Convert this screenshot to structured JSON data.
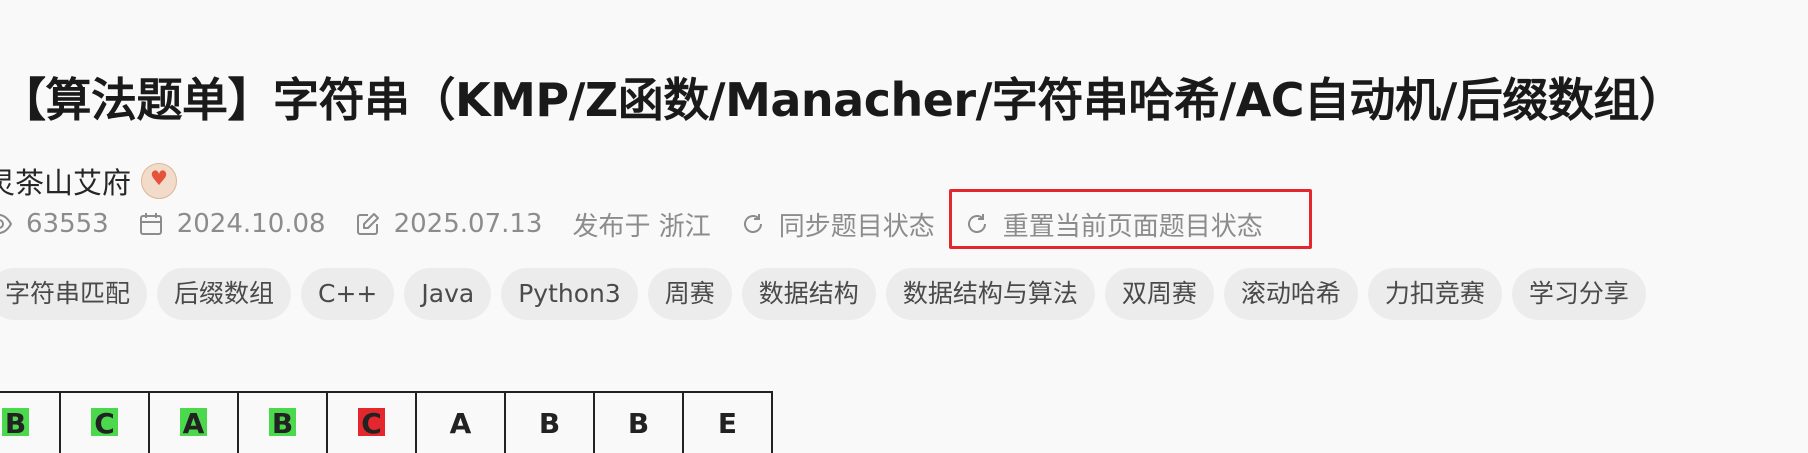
{
  "title": "【算法题单】字符串（KMP/Z函数/Manacher/字符串哈希/AC自动机/后缀数组）",
  "author": "灵茶山艾府",
  "meta": {
    "views": "63553",
    "created": "2024.10.08",
    "edited": "2025.07.13",
    "location": "发布于 浙江",
    "sync_label": "同步题目状态",
    "reset_label": "重置当前页面题目状态"
  },
  "tags": [
    "字符串匹配",
    "后缀数组",
    "C++",
    "Java",
    "Python3",
    "周赛",
    "数据结构",
    "数据结构与算法",
    "双周赛",
    "滚动哈希",
    "力扣竞赛",
    "学习分享"
  ],
  "grid_cells": [
    {
      "letter": "B",
      "mark": "#4cd84c"
    },
    {
      "letter": "C",
      "mark": "#4cd84c"
    },
    {
      "letter": "A",
      "mark": "#4cd84c"
    },
    {
      "letter": "B",
      "mark": "#4cd84c"
    },
    {
      "letter": "C",
      "mark": "#e4262d"
    },
    {
      "letter": "A",
      "mark": ""
    },
    {
      "letter": "B",
      "mark": ""
    },
    {
      "letter": "B",
      "mark": ""
    },
    {
      "letter": "E",
      "mark": ""
    }
  ],
  "colors": {
    "highlight": "#e4262d",
    "match": "#4cd84c",
    "mismatch": "#e4262d"
  },
  "icons": [
    "eye-icon",
    "calendar-icon",
    "edit-icon",
    "refresh-icon"
  ]
}
